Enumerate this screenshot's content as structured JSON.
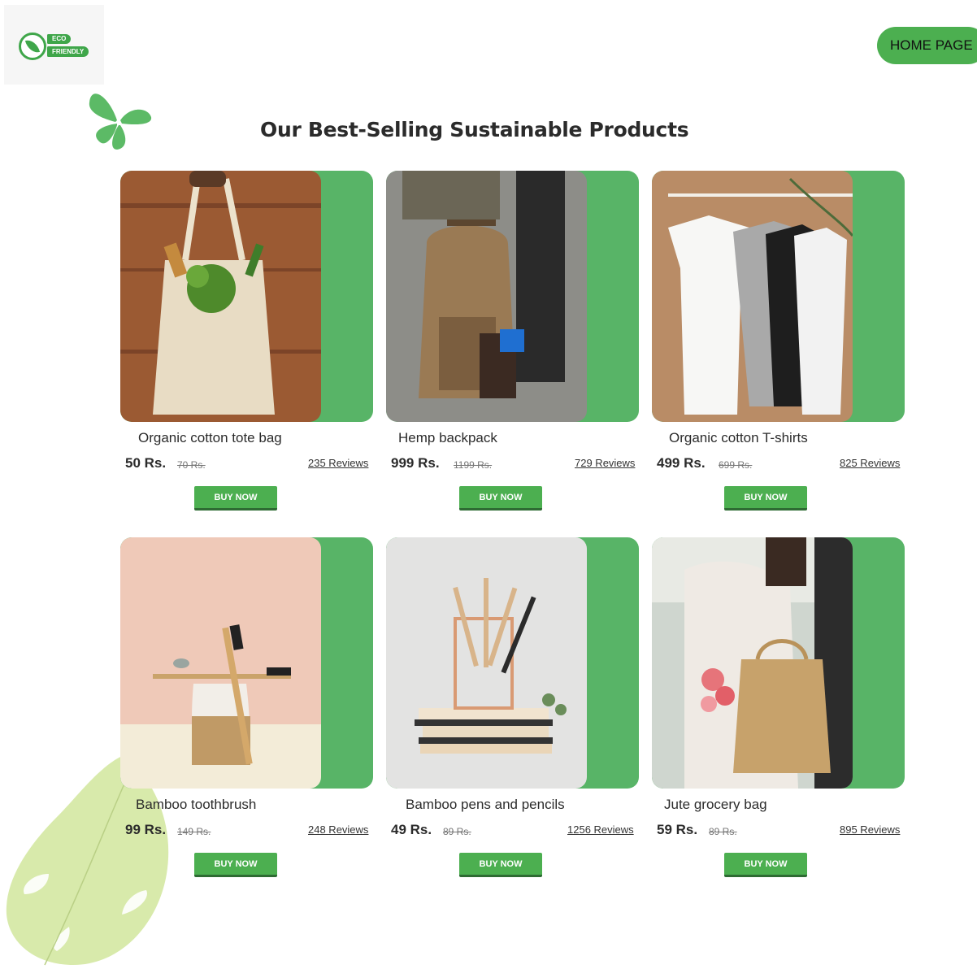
{
  "logo": {
    "line1": "ECO",
    "line2": "FRIENDLY"
  },
  "nav": {
    "home_label": "HOME PAGE"
  },
  "title": "Our Best-Selling Sustainable Products",
  "colors": {
    "accent": "#4caf50",
    "card_bg": "#58b467",
    "leaf": "#d6e9a6"
  },
  "products": [
    {
      "name": "Organic cotton tote bag",
      "price": "50 Rs.",
      "old_price": "70 Rs.",
      "reviews": "235 Reviews",
      "button": "BUY NOW"
    },
    {
      "name": "Hemp backpack",
      "price": "999 Rs.",
      "old_price": "1199 Rs.",
      "reviews": "729 Reviews",
      "button": "BUY NOW"
    },
    {
      "name": "Organic cotton T-shirts",
      "price": "499 Rs.",
      "old_price": "699 Rs.",
      "reviews": "825 Reviews",
      "button": "BUY NOW"
    },
    {
      "name": "Bamboo toothbrush",
      "price": "99 Rs.",
      "old_price": "149 Rs.",
      "reviews": "248 Reviews",
      "button": "BUY NOW"
    },
    {
      "name": "Bamboo pens and pencils",
      "price": "49 Rs.",
      "old_price": "89 Rs.",
      "reviews": "1256 Reviews",
      "button": "BUY NOW"
    },
    {
      "name": "Jute grocery bag",
      "price": "59 Rs.",
      "old_price": "89 Rs.",
      "reviews": "895 Reviews",
      "button": "BUY NOW"
    }
  ]
}
